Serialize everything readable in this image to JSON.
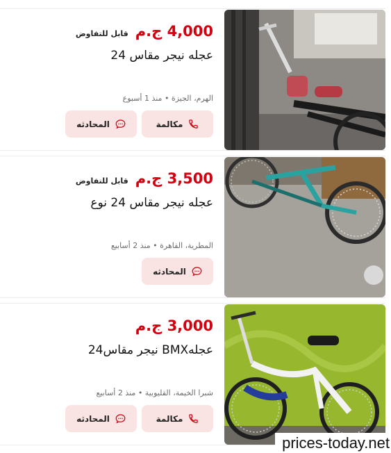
{
  "listings": [
    {
      "price": "4,000 ج.م",
      "negotiable": "قابل للتفاوض",
      "title": "عجله نيجر مقاس 24",
      "meta": "الهرم، الجيزة • منذ 1 أسبوع",
      "call_label": "مكالمة",
      "chat_label": "المحادثه"
    },
    {
      "price": "3,500 ج.م",
      "negotiable": "قابل للتفاوض",
      "title": "عجله نيجر مقاس 24 نوع",
      "meta": "المطرية، القاهرة • منذ 2 أسابيع",
      "chat_label": "المحادثه"
    },
    {
      "price": "3,000 ج.م",
      "title": "عجلهBMX نيجر مقاس24",
      "meta": "شبرا الخيمة، القليوبية • منذ 2 أسابيع",
      "call_label": "مكالمة",
      "chat_label": "المحادثه"
    }
  ],
  "watermark": "prices-today.net",
  "colors": {
    "price": "#d4000f",
    "button_bg": "#f9e3e3",
    "icon": "#d4000f"
  },
  "icons": {
    "call": "phone-icon",
    "chat": "chat-bubble-icon"
  }
}
